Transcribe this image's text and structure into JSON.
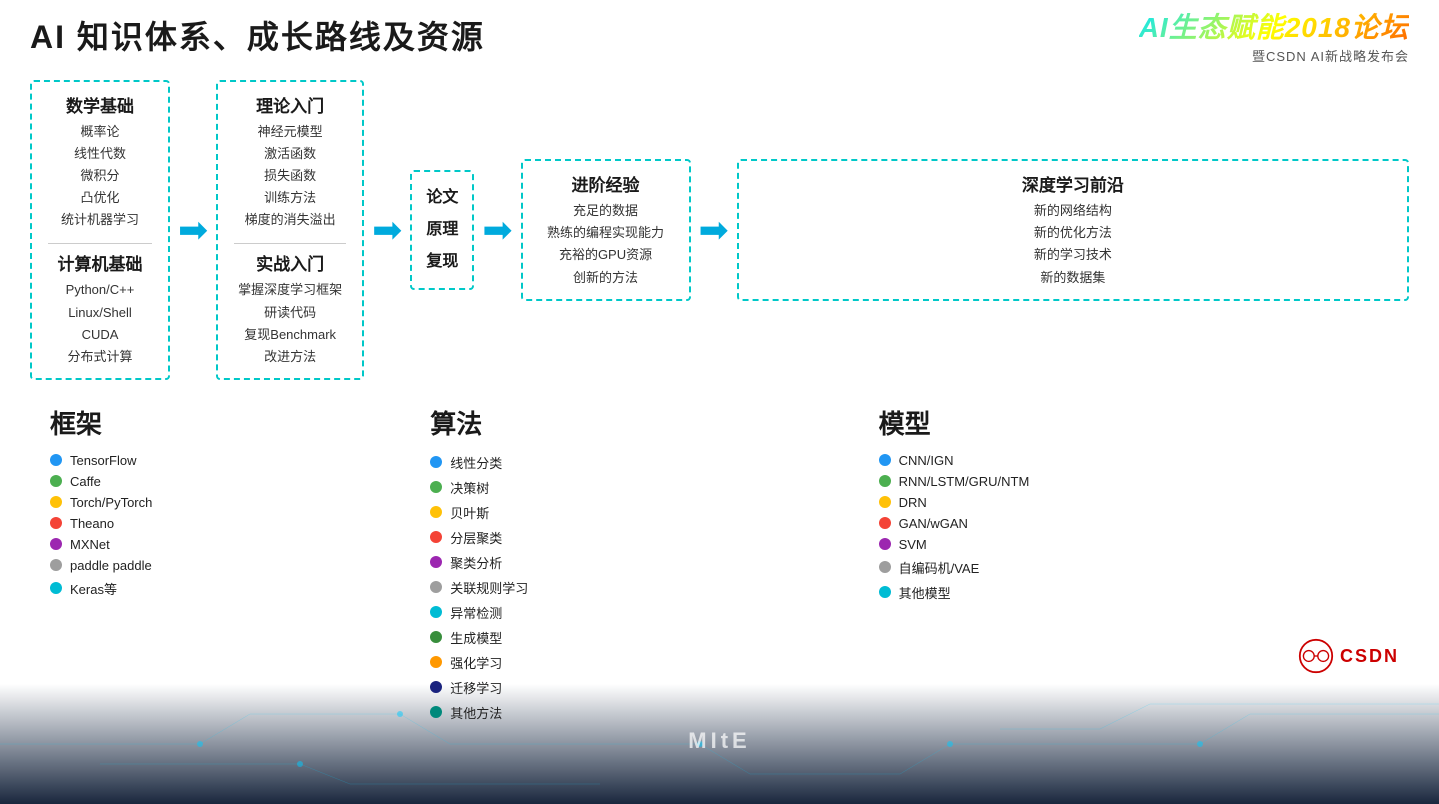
{
  "header": {
    "title": "AI 知识体系、成长路线及资源",
    "logo_title": "AI生态赋能2018论坛",
    "logo_subtitle": "暨CSDN AI新战略发布会"
  },
  "flow": {
    "box1": {
      "section1_title": "数学基础",
      "section1_items": [
        "概率论",
        "线性代数",
        "微积分",
        "凸优化",
        "统计机器学习"
      ],
      "section2_title": "计算机基础",
      "section2_items": [
        "Python/C++",
        "Linux/Shell",
        "CUDA",
        "分布式计算"
      ]
    },
    "arrow1": "→",
    "box2": {
      "section1_title": "理论入门",
      "section1_items": [
        "神经元模型",
        "激活函数",
        "损失函数",
        "训练方法",
        "梯度的消失溢出"
      ],
      "section2_title": "实战入门",
      "section2_items": [
        "掌握深度学习框架",
        "研读代码",
        "复现Benchmark",
        "改进方法"
      ]
    },
    "arrow2": "→",
    "box3": {
      "title_lines": [
        "论文",
        "原理",
        "复现"
      ]
    },
    "arrow3": "→",
    "box4": {
      "title": "进阶经验",
      "items": [
        "充足的数据",
        "熟练的编程实现能力",
        "充裕的GPU资源",
        "创新的方法"
      ]
    },
    "arrow4": "→",
    "box5": {
      "title": "深度学习前沿",
      "items": [
        "新的网络结构",
        "新的优化方法",
        "新的学习技术",
        "新的数据集"
      ]
    }
  },
  "bottom": {
    "panel_frameworks": {
      "title": "框架",
      "items": [
        {
          "color": "#2196F3",
          "label": "TensorFlow"
        },
        {
          "color": "#4CAF50",
          "label": "Caffe"
        },
        {
          "color": "#FFC107",
          "label": "Torch/PyTorch"
        },
        {
          "color": "#F44336",
          "label": "Theano"
        },
        {
          "color": "#9C27B0",
          "label": "MXNet"
        },
        {
          "color": "#9E9E9E",
          "label": "paddle paddle"
        },
        {
          "color": "#00BCD4",
          "label": "Keras等"
        }
      ]
    },
    "panel_algorithms": {
      "title": "算法",
      "items": [
        {
          "color": "#2196F3",
          "label": "线性分类"
        },
        {
          "color": "#4CAF50",
          "label": "决策树"
        },
        {
          "color": "#FFC107",
          "label": "贝叶斯"
        },
        {
          "color": "#F44336",
          "label": "分层聚类"
        },
        {
          "color": "#9C27B0",
          "label": "聚类分析"
        },
        {
          "color": "#9E9E9E",
          "label": "关联规则学习"
        },
        {
          "color": "#00BCD4",
          "label": "异常检测"
        },
        {
          "color": "#388E3C",
          "label": "生成模型"
        },
        {
          "color": "#FF9800",
          "label": "强化学习"
        },
        {
          "color": "#1A237E",
          "label": "迁移学习"
        },
        {
          "color": "#00897B",
          "label": "其他方法"
        }
      ]
    },
    "panel_models": {
      "title": "模型",
      "items": [
        {
          "color": "#2196F3",
          "label": "CNN/IGN"
        },
        {
          "color": "#4CAF50",
          "label": "RNN/LSTM/GRU/NTM"
        },
        {
          "color": "#FFC107",
          "label": "DRN"
        },
        {
          "color": "#F44336",
          "label": "GAN/wGAN"
        },
        {
          "color": "#9C27B0",
          "label": "SVM"
        },
        {
          "color": "#9E9E9E",
          "label": "自编码机/VAE"
        },
        {
          "color": "#00BCD4",
          "label": "其他模型"
        }
      ]
    }
  },
  "mite": "MItE",
  "csdn": "CSDN"
}
